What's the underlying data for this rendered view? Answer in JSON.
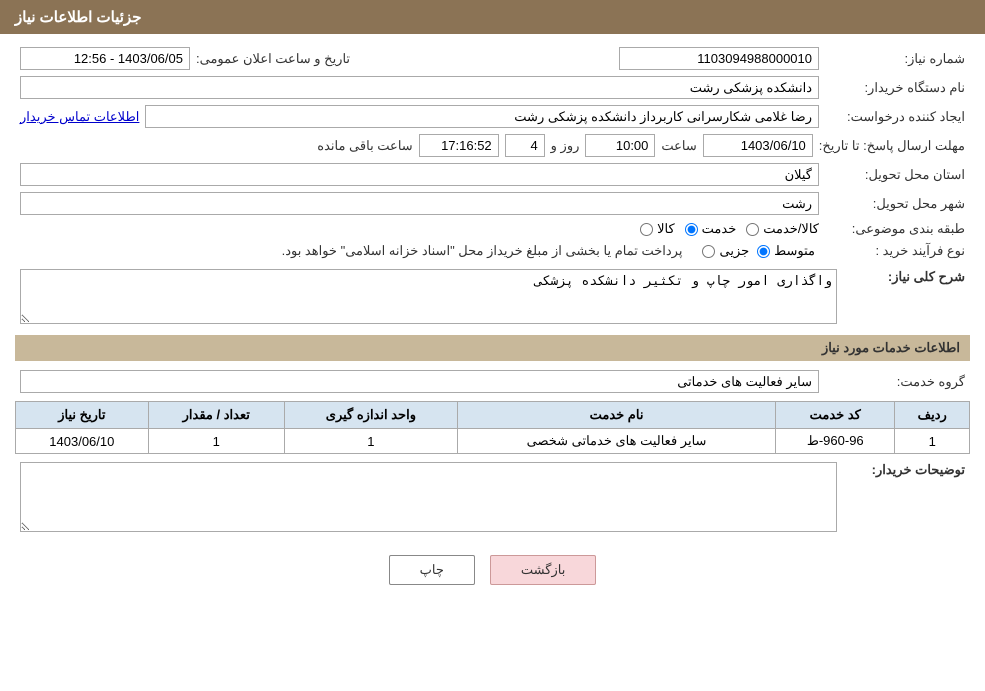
{
  "header": {
    "title": "جزئیات اطلاعات نیاز"
  },
  "form": {
    "need_number_label": "شماره نیاز:",
    "need_number_value": "1103094988000010",
    "buyer_org_label": "نام دستگاه خریدار:",
    "buyer_org_value": "دانشکده پزشکی رشت",
    "announcement_label": "تاریخ و ساعت اعلان عمومی:",
    "announcement_value": "1403/06/05 - 12:56",
    "creator_label": "ایجاد کننده درخواست:",
    "creator_value": "رضا غلامی شکارسرانی کاربرداز دانشکده پزشکی رشت",
    "contact_link": "اطلاعات تماس خریدار",
    "deadline_label": "مهلت ارسال پاسخ: تا تاریخ:",
    "deadline_date": "1403/06/10",
    "deadline_time_label": "ساعت",
    "deadline_time": "10:00",
    "deadline_day_label": "روز و",
    "deadline_days": "4",
    "deadline_remaining_label": "ساعت باقی مانده",
    "deadline_remaining_time": "17:16:52",
    "province_label": "استان محل تحویل:",
    "province_value": "گیلان",
    "city_label": "شهر محل تحویل:",
    "city_value": "رشت",
    "category_label": "طبقه بندی موضوعی:",
    "category_options": [
      "کالا",
      "خدمت",
      "کالا/خدمت"
    ],
    "category_selected": "خدمت",
    "process_label": "نوع فرآیند خرید :",
    "process_options": [
      "جزیی",
      "متوسط"
    ],
    "process_selected": "متوسط",
    "process_description": "پرداخت تمام یا بخشی از مبلغ خریداز محل \"اسناد خزانه اسلامی\" خواهد بود.",
    "need_description_label": "شرح کلی نیاز:",
    "need_description_value": "واگذاری امور چاپ و تکثیر دانشکده پزشکی",
    "services_section_title": "اطلاعات خدمات مورد نیاز",
    "service_group_label": "گروه خدمت:",
    "service_group_value": "سایر فعالیت های خدماتی",
    "table": {
      "headers": [
        "ردیف",
        "کد خدمت",
        "نام خدمت",
        "واحد اندازه گیری",
        "تعداد / مقدار",
        "تاریخ نیاز"
      ],
      "rows": [
        {
          "row": "1",
          "service_code": "960-96-ط",
          "service_name": "سایر فعالیت های خدماتی شخصی",
          "unit": "1",
          "quantity": "1",
          "date": "1403/06/10"
        }
      ]
    },
    "buyer_notes_label": "توضیحات خریدار:"
  },
  "buttons": {
    "print_label": "چاپ",
    "back_label": "بازگشت"
  }
}
